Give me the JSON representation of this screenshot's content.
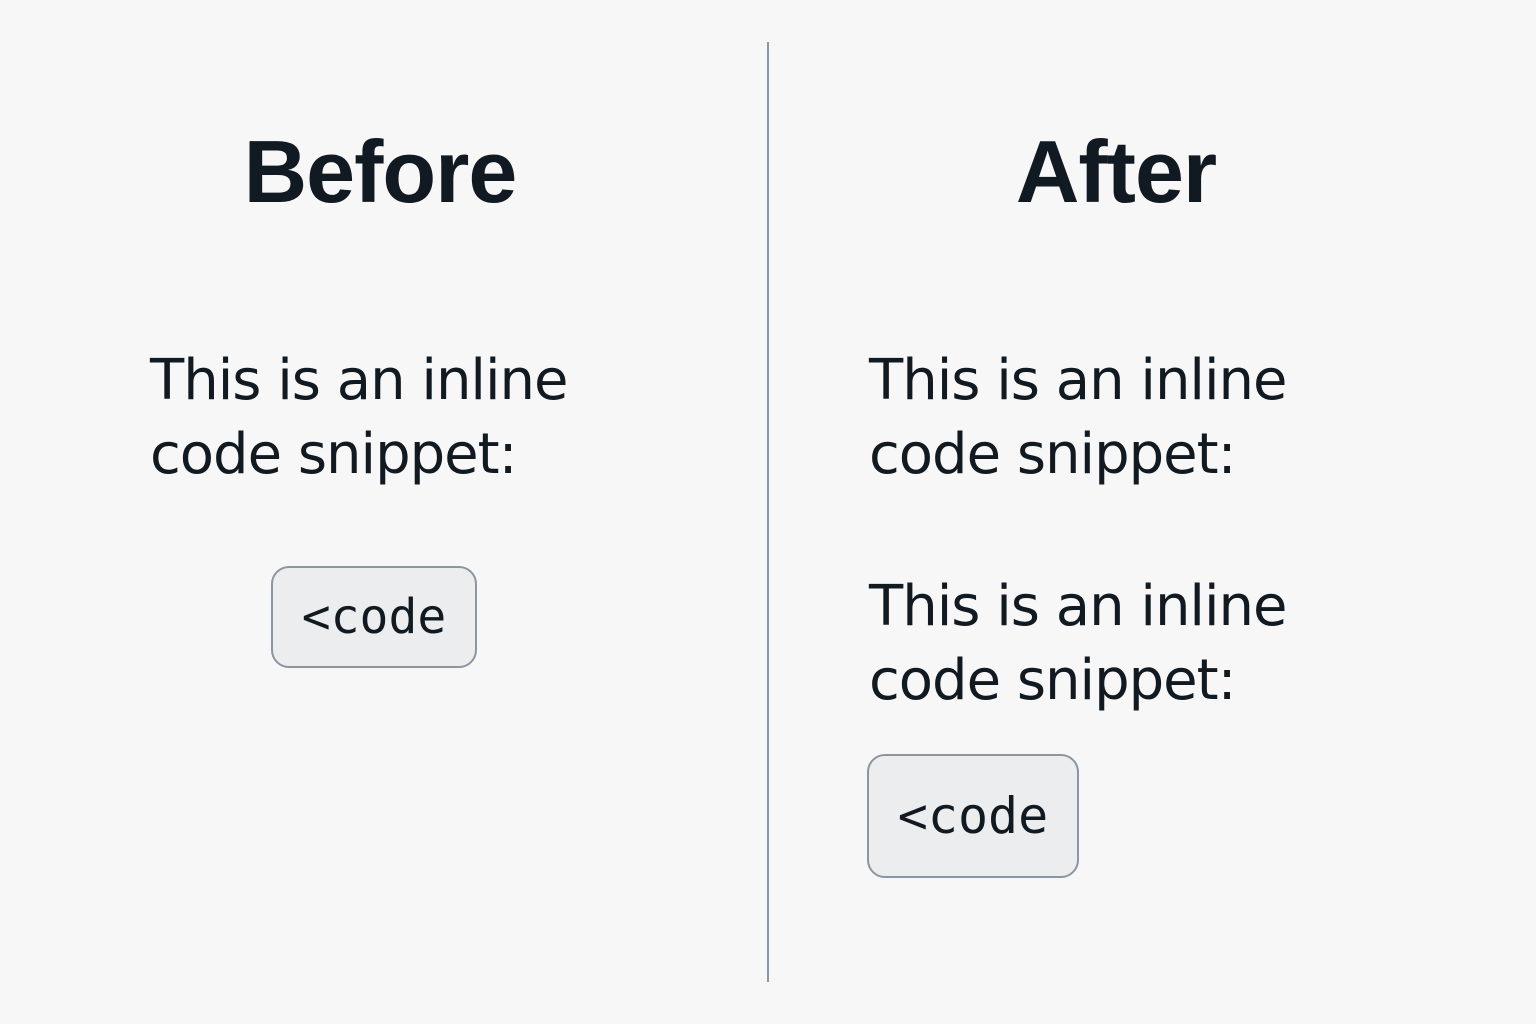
{
  "before": {
    "heading": "Before",
    "paragraph": {
      "line1": "This is an inline",
      "line2": "code snippet:"
    },
    "code": "<code"
  },
  "after": {
    "heading": "After",
    "paragraphs": [
      {
        "line1": "This is an inline",
        "line2": "code snippet:"
      },
      {
        "line1": "This is an inline",
        "line2": "code snippet:"
      }
    ],
    "code": "<code"
  },
  "colors": {
    "background": "#f7f7f7",
    "text": "#111921",
    "divider": "#8b96a3",
    "code_background": "#ebedef",
    "code_border": "#8b96a3"
  }
}
